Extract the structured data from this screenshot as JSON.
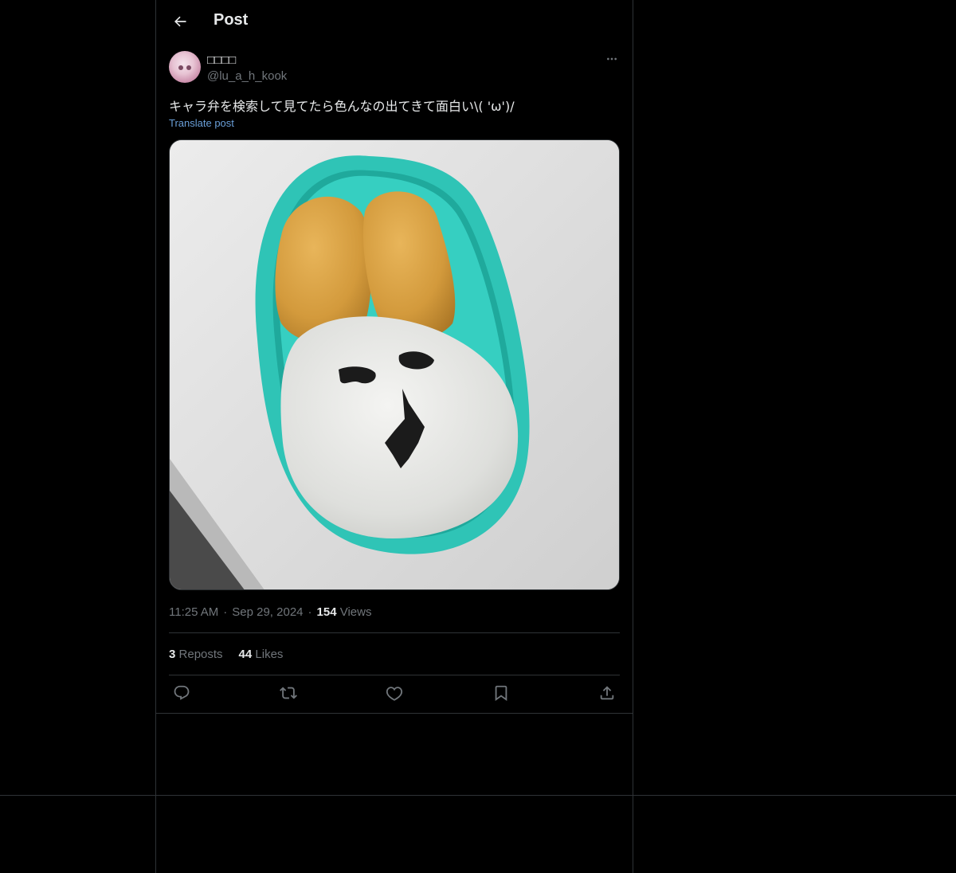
{
  "header": {
    "title": "Post",
    "back_icon": "arrow-left-icon"
  },
  "author": {
    "display_name": "□□□□",
    "handle": "@lu_a_h_kook",
    "more_icon": "more-horizontal-icon"
  },
  "post": {
    "text": "キャラ弁を検索して見てたら色んなの出てきて面白い\\( 'ω')/",
    "translate_label": "Translate post",
    "time": "11:25 AM",
    "separator": "·",
    "date": "Sep 29, 2024",
    "views_count": "154",
    "views_label": "Views"
  },
  "stats": {
    "reposts_count": "3",
    "reposts_label": "Reposts",
    "likes_count": "44",
    "likes_label": "Likes"
  },
  "actions": [
    {
      "name": "reply-button",
      "icon": "reply-icon"
    },
    {
      "name": "repost-button",
      "icon": "repost-icon"
    },
    {
      "name": "like-button",
      "icon": "heart-icon"
    },
    {
      "name": "bookmark-button",
      "icon": "bookmark-icon"
    },
    {
      "name": "share-button",
      "icon": "share-icon"
    }
  ],
  "colors": {
    "background": "#000000",
    "border": "#2f3336",
    "text_primary": "#e7e9ea",
    "text_secondary": "#71767b",
    "link": "#6a9fd8",
    "lunchbox": "#2fc4b6"
  }
}
